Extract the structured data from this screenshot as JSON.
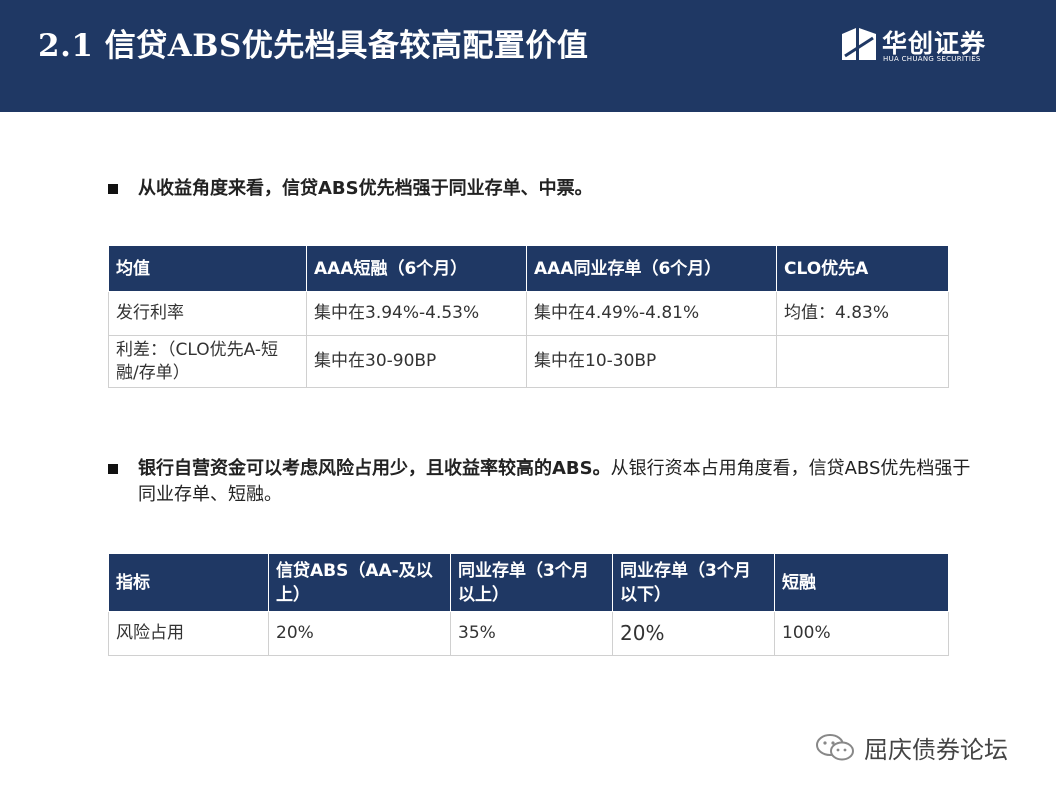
{
  "header": {
    "title": "2.1 信贷ABS优先档具备较高配置价值",
    "logo_cn": "华创证券",
    "logo_en": "HUA CHUANG SECURITIES"
  },
  "bullets": [
    {
      "bold": "从收益角度来看，信贷ABS优先档强于同业存单、中票。",
      "normal": ""
    },
    {
      "bold": "银行自营资金可以考虑风险占用少，且收益率较高的ABS。",
      "normal": "从银行资本占用角度看，信贷ABS优先档强于同业存单、短融。"
    }
  ],
  "table1": {
    "headers": [
      "均值",
      "AAA短融（6个月）",
      "AAA同业存单（6个月）",
      "CLO优先A"
    ],
    "rows": [
      [
        "发行利率",
        "集中在3.94%-4.53%",
        "集中在4.49%-4.81%",
        "均值：4.83%"
      ],
      [
        "利差：（CLO优先A-短融/存单）",
        "集中在30-90BP",
        "集中在10-30BP",
        ""
      ]
    ]
  },
  "table2": {
    "headers": [
      "指标",
      "信贷ABS（AA-及以上）",
      "同业存单（3个月以上）",
      "同业存单（3个月以下）",
      "短融"
    ],
    "rows": [
      [
        "风险占用",
        "20%",
        "35%",
        "20%",
        "100%"
      ]
    ]
  },
  "watermark": {
    "text": "屈庆债券论坛",
    "icon": "wechat-icon"
  },
  "colors": {
    "header_bg": "#1f3864",
    "table_header_bg": "#1f3864"
  }
}
